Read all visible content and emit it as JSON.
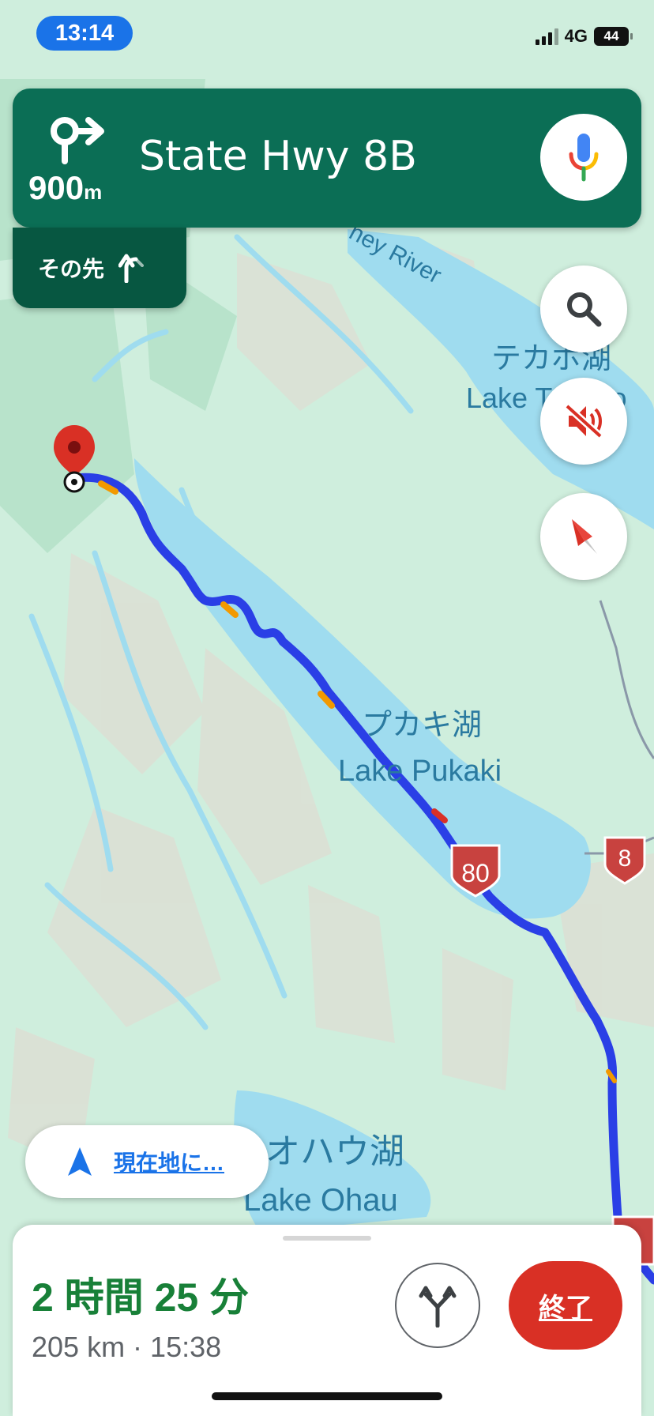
{
  "status_bar": {
    "time": "13:14",
    "network": "4G",
    "battery": "44"
  },
  "navigation": {
    "distance_value": "900",
    "distance_unit": "m",
    "street": "State Hwy 8B",
    "then_label": "その先"
  },
  "map": {
    "labels": {
      "river": "ney River",
      "lake_tekapo_ja": "テカポ湖",
      "lake_tekapo_en": "Lake Tekapo",
      "lake_pukaki_ja": "プカキ湖",
      "lake_pukaki_en": "Lake Pukaki",
      "lake_ohau_ja": "オハウ湖",
      "lake_ohau_en": "Lake Ohau"
    },
    "route_shields": [
      "80",
      "8"
    ],
    "colors": {
      "route": "#2a3fe6",
      "traffic_slow": "#f29900",
      "traffic_heavy": "#d93025",
      "water": "#9fdcef"
    }
  },
  "controls": {
    "recenter_label": "現在地に…"
  },
  "trip": {
    "duration": "2 時間 25 分",
    "info": "205 km · 15:38",
    "exit_label": "終了"
  }
}
